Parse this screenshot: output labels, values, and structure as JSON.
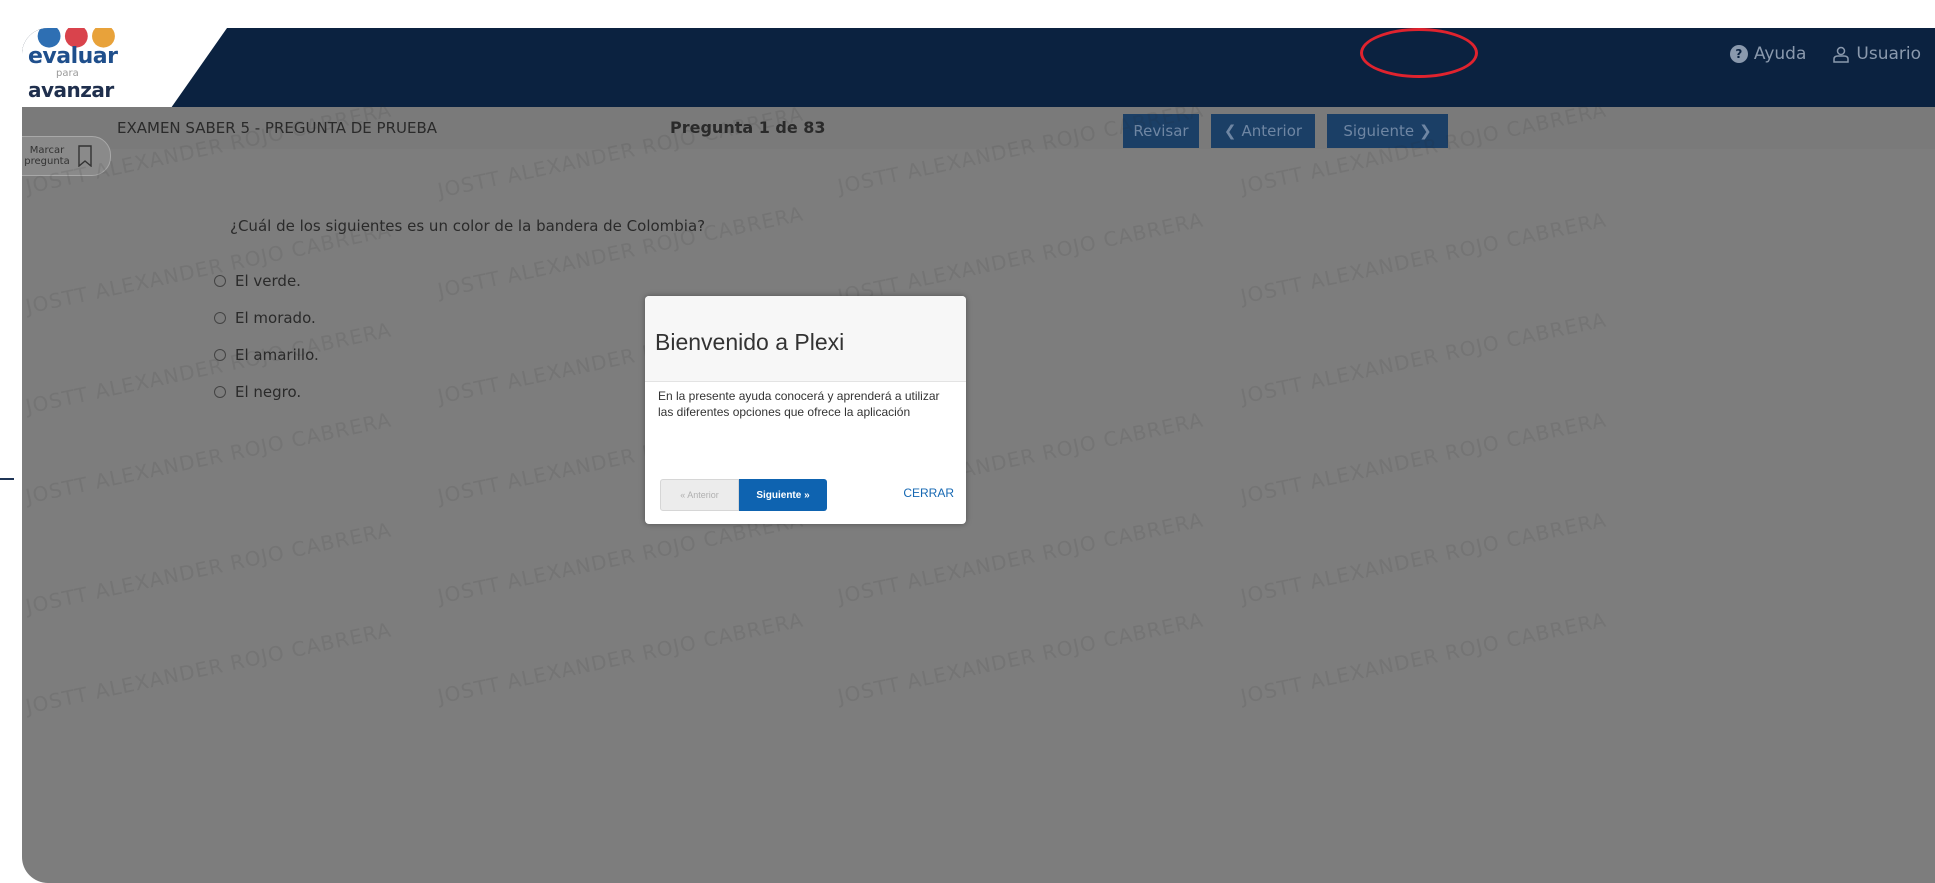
{
  "logo": {
    "dots": [
      "●",
      "●",
      "●"
    ],
    "line1": "evaluar",
    "line2": "para",
    "line3": "avanzar"
  },
  "header": {
    "help_label": "Ayuda",
    "user_label": "Usuario"
  },
  "exam": {
    "title": "EXAMEN SABER 5 - PREGUNTA DE PRUEBA",
    "counter": "Pregunta 1 de 83",
    "review_label": "Revisar",
    "prev_label": "Anterior",
    "next_label": "Siguiente",
    "mark_label": "Marcar pregunta"
  },
  "question": {
    "text": "¿Cuál de los siguientes es un color de la bandera de Colombia?",
    "options": [
      "El verde.",
      "El morado.",
      "El amarillo.",
      "El negro."
    ]
  },
  "watermark_text": "JOSTT ALEXANDER ROJO CABRERA",
  "dialog": {
    "title": "Bienvenido a Plexi",
    "body": "En la presente ayuda conocerá y aprenderá a utilizar las diferentes opciones que ofrece la aplicación",
    "prev_label": "« Anterior",
    "next_label": "Siguiente »",
    "close_label": "CERRAR"
  },
  "colors": {
    "navy_header": "#0b2240",
    "overlay_gray": "#7d7d7d",
    "primary_button": "#0e63b0",
    "highlight_circle": "#e0232e"
  },
  "icons": [
    "help-circle-icon",
    "user-icon",
    "chevron-left-icon",
    "chevron-right-icon",
    "bookmark-icon",
    "radio-icon"
  ]
}
